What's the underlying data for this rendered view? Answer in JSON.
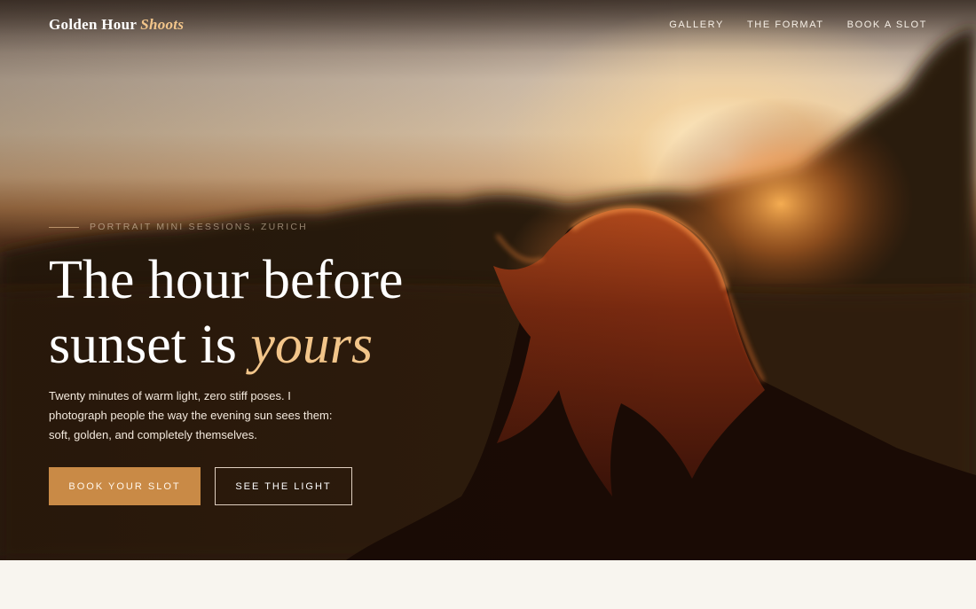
{
  "brand": {
    "name": "Golden Hour",
    "accent": "Shoots"
  },
  "nav": {
    "items": [
      "GALLERY",
      "THE FORMAT",
      "BOOK A SLOT"
    ]
  },
  "hero": {
    "eyebrow": "PORTRAIT MINI SESSIONS, ZURICH",
    "headline": {
      "line1": "The hour before",
      "line2_prefix": "sunset is",
      "line2_emphasis": "yours"
    },
    "lede": "Twenty minutes of warm light, zero stiff poses. I photograph people the way the evening sun sees them: soft, golden, and completely themselves.",
    "primary_button": "BOOK YOUR SLOT",
    "secondary_button": "SEE THE LIGHT",
    "image": "backlit-woman-in-field-at-sunset"
  },
  "colors": {
    "accent": "#c98a46",
    "accent_text": "#f2c58a",
    "page_background": "#f8f5ef"
  }
}
